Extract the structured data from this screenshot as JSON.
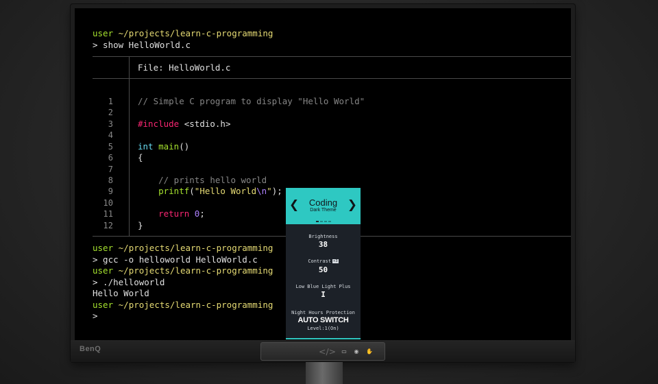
{
  "monitor": {
    "brand": "BenQ",
    "controller_icons": [
      "code-icon",
      "monitor-icon",
      "settings-icon",
      "hand-icon"
    ]
  },
  "terminal": {
    "prompt_user": "user",
    "prompt_path": "~/projects/learn-c-programming",
    "cmd1": "> show HelloWorld.c",
    "file_header": "File: HelloWorld.c",
    "cmd2": "> gcc -o helloworld HelloWorld.c",
    "cmd3": "> ./helloworld",
    "output": "Hello World",
    "cmd4": ">"
  },
  "code": {
    "line_numbers": [
      "1",
      "2",
      "3",
      "4",
      "5",
      "6",
      "7",
      "8",
      "9",
      "10",
      "11",
      "12"
    ],
    "l1": "// Simple C program to display \"Hello World\"",
    "l3_pre": "#include",
    "l3_rest": " <stdio.h>",
    "l5_kw": "int",
    "l5_fn": " main",
    "l5_rest": "()",
    "l6": "{",
    "l8": "    // prints hello world",
    "l9_fn": "    printf",
    "l9_open": "(",
    "l9_str1": "\"Hello World",
    "l9_esc": "\\n",
    "l9_str2": "\"",
    "l9_close": ");",
    "l11_ret": "    return",
    "l11_num": " 0",
    "l11_rest": ";",
    "l12": "}"
  },
  "osd": {
    "mode": "Coding",
    "theme": "Dark Theme",
    "brightness_label": "Brightness",
    "brightness_value": "38",
    "contrast_label": "Contrast",
    "contrast_badge": "+3",
    "contrast_value": "50",
    "low_blue_label": "Low Blue Light Plus",
    "low_blue_value": "I",
    "night_label": "Night Hours Protection",
    "night_value": "AUTO SWITCH",
    "level": "Level:1(On)"
  },
  "colors": {
    "accent": "#2ec8c2",
    "prompt_user": "#a6e22e",
    "prompt_path": "#e6db74"
  }
}
